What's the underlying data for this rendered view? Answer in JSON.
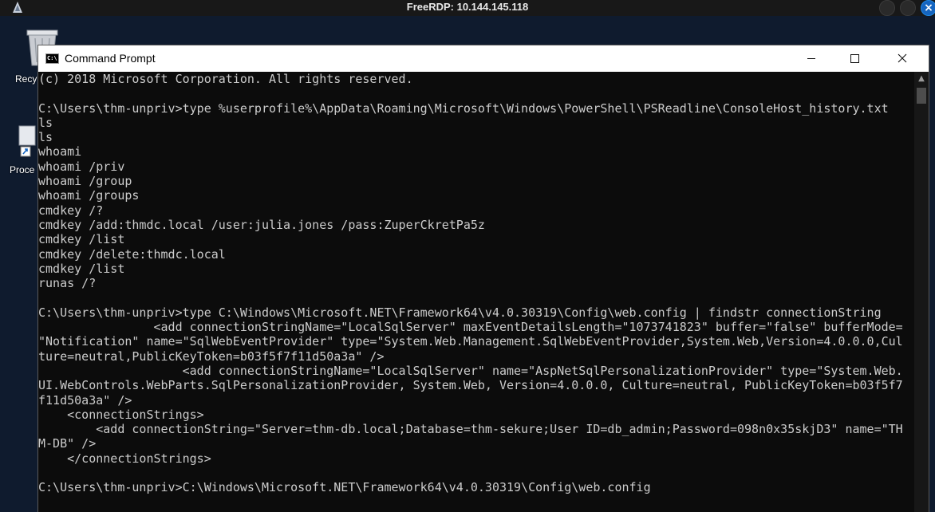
{
  "rdp": {
    "title": "FreeRDP: 10.144.145.118"
  },
  "desktop": {
    "icons": [
      {
        "label": "Recy",
        "icon": "recycle-bin-icon"
      },
      {
        "label": "Proce",
        "icon": "shortcut-icon"
      }
    ]
  },
  "window": {
    "title": "Command Prompt",
    "minimize": "—",
    "maximize": "☐",
    "close": "✕"
  },
  "console": {
    "lines": [
      "(c) 2018 Microsoft Corporation. All rights reserved.",
      "",
      "C:\\Users\\thm-unpriv>type %userprofile%\\AppData\\Roaming\\Microsoft\\Windows\\PowerShell\\PSReadline\\ConsoleHost_history.txt",
      "ls",
      "ls",
      "whoami",
      "whoami /priv",
      "whoami /group",
      "whoami /groups",
      "cmdkey /?",
      "cmdkey /add:thmdc.local /user:julia.jones /pass:ZuperCkretPa5z",
      "cmdkey /list",
      "cmdkey /delete:thmdc.local",
      "cmdkey /list",
      "runas /?",
      "",
      "C:\\Users\\thm-unpriv>type C:\\Windows\\Microsoft.NET\\Framework64\\v4.0.30319\\Config\\web.config | findstr connectionString",
      "                <add connectionStringName=\"LocalSqlServer\" maxEventDetailsLength=\"1073741823\" buffer=\"false\" bufferMode=",
      "\"Notification\" name=\"SqlWebEventProvider\" type=\"System.Web.Management.SqlWebEventProvider,System.Web,Version=4.0.0.0,Cul",
      "ture=neutral,PublicKeyToken=b03f5f7f11d50a3a\" />",
      "                    <add connectionStringName=\"LocalSqlServer\" name=\"AspNetSqlPersonalizationProvider\" type=\"System.Web.",
      "UI.WebControls.WebParts.SqlPersonalizationProvider, System.Web, Version=4.0.0.0, Culture=neutral, PublicKeyToken=b03f5f7",
      "f11d50a3a\" />",
      "    <connectionStrings>",
      "        <add connectionString=\"Server=thm-db.local;Database=thm-sekure;User ID=db_admin;Password=098n0x35skjD3\" name=\"TH",
      "M-DB\" />",
      "    </connectionStrings>",
      "",
      "C:\\Users\\thm-unpriv>C:\\Windows\\Microsoft.NET\\Framework64\\v4.0.30319\\Config\\web.config"
    ]
  },
  "colors": {
    "console_bg": "#0c0c0c",
    "console_fg": "#cccccc",
    "rdp_close": "#1565c0"
  }
}
